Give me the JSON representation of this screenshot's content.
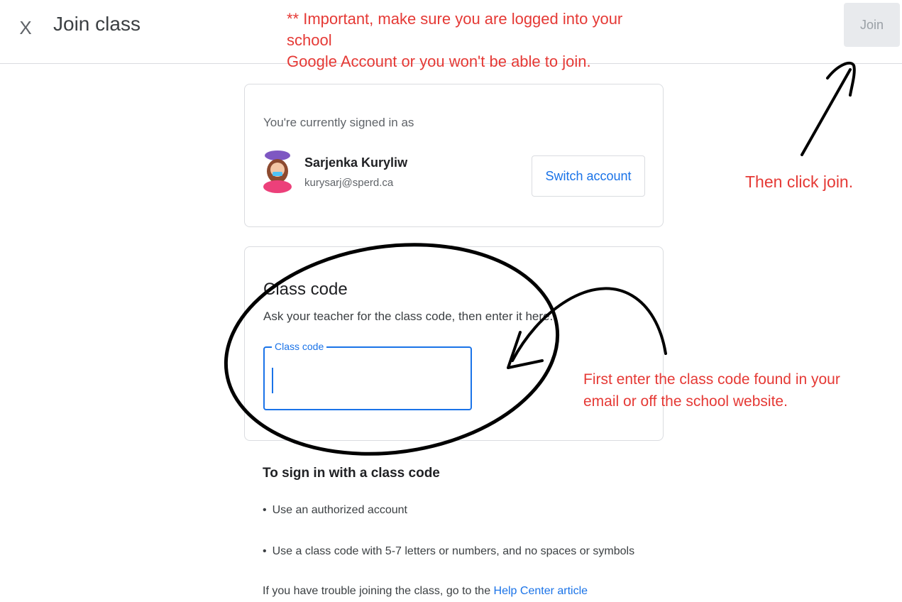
{
  "header": {
    "close_glyph": "X",
    "title": "Join class",
    "join_label": "Join"
  },
  "warning": {
    "line1": "** Important, make sure you are logged into your school",
    "line2": "Google Account or you won't be able to join."
  },
  "account": {
    "signed_in_label": "You're currently signed in as",
    "name": "Sarjenka Kuryliw",
    "email": "kurysarj@sperd.ca",
    "switch_label": "Switch account"
  },
  "class_code": {
    "heading": "Class code",
    "description": "Ask your teacher for the class code, then enter it here.",
    "field_label": "Class code",
    "value": ""
  },
  "instructions": {
    "heading": "To sign in with a class code",
    "bullets": [
      "Use an authorized account",
      "Use a class code with 5-7 letters or numbers, and no spaces or symbols"
    ],
    "help_prefix": "If you have trouble joining the class, go to the ",
    "help_link": "Help Center article"
  },
  "annotations": {
    "join_note": "Then click join.",
    "code_note_line1": "First enter the class code found in your",
    "code_note_line2": "email or off the school website."
  },
  "colors": {
    "accent": "#1a73e8",
    "annotation_red": "#e53935",
    "border": "#dadce0"
  }
}
